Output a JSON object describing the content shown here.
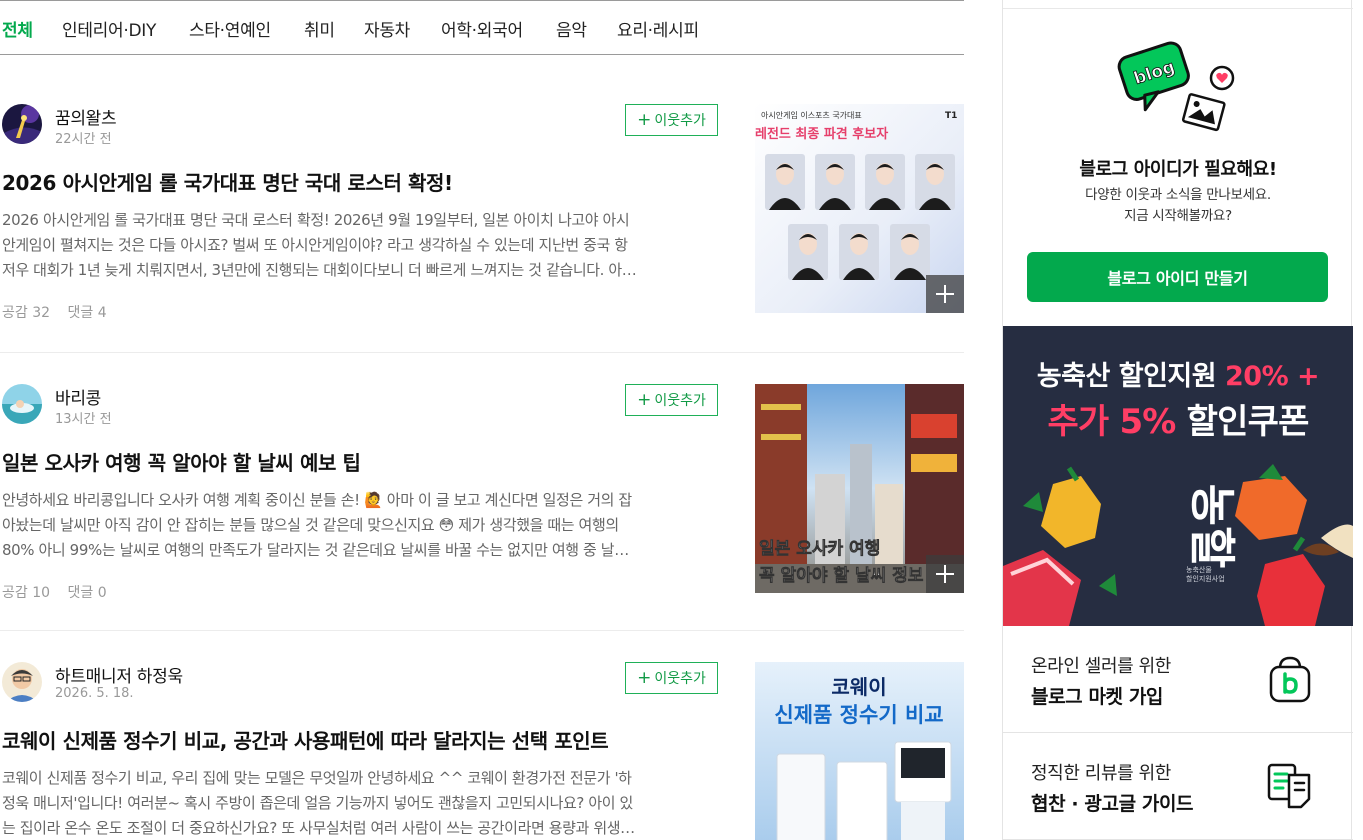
{
  "tabs": [
    "전체",
    "인테리어·DIY",
    "스타·연예인",
    "취미",
    "자동차",
    "어학·외국어",
    "음악",
    "요리·레시피"
  ],
  "follow_label": "이웃추가",
  "posts": [
    {
      "author": "꿈의왈츠",
      "time": "22시간 전",
      "title": "2026 아시안게임 롤 국가대표 명단 국대 로스터 확정!",
      "excerpt": [
        "2026 아시안게임 롤 국가대표 명단 국대 로스터 확정! 2026년 9월 19일부터, 일본 아이치 나고야 아시",
        "안게임이 펼쳐지는 것은 다들 아시죠? 벌써 또 아시안게임이야? 라고 생각하실 수 있는데 지난번 중국 항",
        "저우 대회가 1년 늦게 치뤄지면서, 3년만에 진행되는 대회이다보니 더 빠르게 느껴지는 것 같습니다. 아…"
      ],
      "likes": "공감 32",
      "comments": "댓글 4",
      "thumb": {
        "header": "아시안게임 이스포츠 국가대표",
        "headline": "레전드 최종 파견 후보자",
        "corner": "T1",
        "accent": "#e63f6b"
      }
    },
    {
      "author": "바리콩",
      "time": "13시간 전",
      "title": "일본 오사카 여행 꼭 알아야 할 날씨 예보 팁",
      "excerpt": [
        "안녕하세요 바리콩입니다 오사카 여행 계획 중이신 분들 손! 🙋 아마 이 글 보고 계신다면 일정은 거의 잡",
        "아놨는데 날씨만 아직 감이 안 잡히는 분들 많으실 것 같은데 맞으신지요 😳 제가 생각했을 때는 여행의",
        "80% 아니 99%는 날씨로 여행의 만족도가 달라지는 것 같은데요 날씨를 바꿀 수는 없지만 여행 중 날…"
      ],
      "likes": "공감 10",
      "comments": "댓글 0",
      "thumb": {
        "line1": "일본 오사카 여행",
        "line2": "꼭 알아야 할 날씨 정보"
      }
    },
    {
      "author": "하트매니저 하정욱",
      "time": "2026. 5. 18.",
      "title": "코웨이 신제품 정수기 비교, 공간과 사용패턴에 따라 달라지는 선택 포인트",
      "excerpt": [
        "코웨이 신제품 정수기 비교, 우리 집에 맞는 모델은 무엇일까 안녕하세요 ^^ 코웨이 환경가전 전문가 '하",
        "정욱 매니저'입니다! 여러분~ 혹시 주방이 좁은데 얼음 기능까지 넣어도 괜찮을지 고민되시나요? 아이 있",
        "는 집이라 온수 온도 조절이 더 중요하신가요? 또 사무실처럼 여러 사람이 쓰는 공간이라면 용량과 위생…"
      ],
      "likes": "",
      "comments": "",
      "thumb": {
        "line1": "코웨이",
        "line2": "신제품 정수기 비교"
      }
    }
  ],
  "sidebar": {
    "illustration_text": "blog",
    "id_title": "블로그 아이디가 필요해요!",
    "id_desc": [
      "다양한 이웃과 소식을 만나보세요.",
      "지금 시작해볼까요?"
    ],
    "make_id_button": "블로그 아이디 만들기",
    "ad": {
      "line1_white": "농축산 할인지원 ",
      "line1_pink": "20% +",
      "line2_pink": "추가 5% ",
      "line2_white": "할인쿠폰",
      "logo_text": "농할",
      "small": [
        "농축산물",
        "할인지원사업"
      ]
    },
    "banners": [
      {
        "sub": "온라인 셀러를 위한",
        "main": "블로그 마켓 가입"
      },
      {
        "sub": "정직한 리뷰를 위한",
        "main": "협찬 · 광고글 가이드"
      }
    ]
  },
  "colors": {
    "accent_green": "#03a94d",
    "follow_border": "#1fb058",
    "ad_bg": "#262d41",
    "ad_pink": "#ff3e65"
  }
}
